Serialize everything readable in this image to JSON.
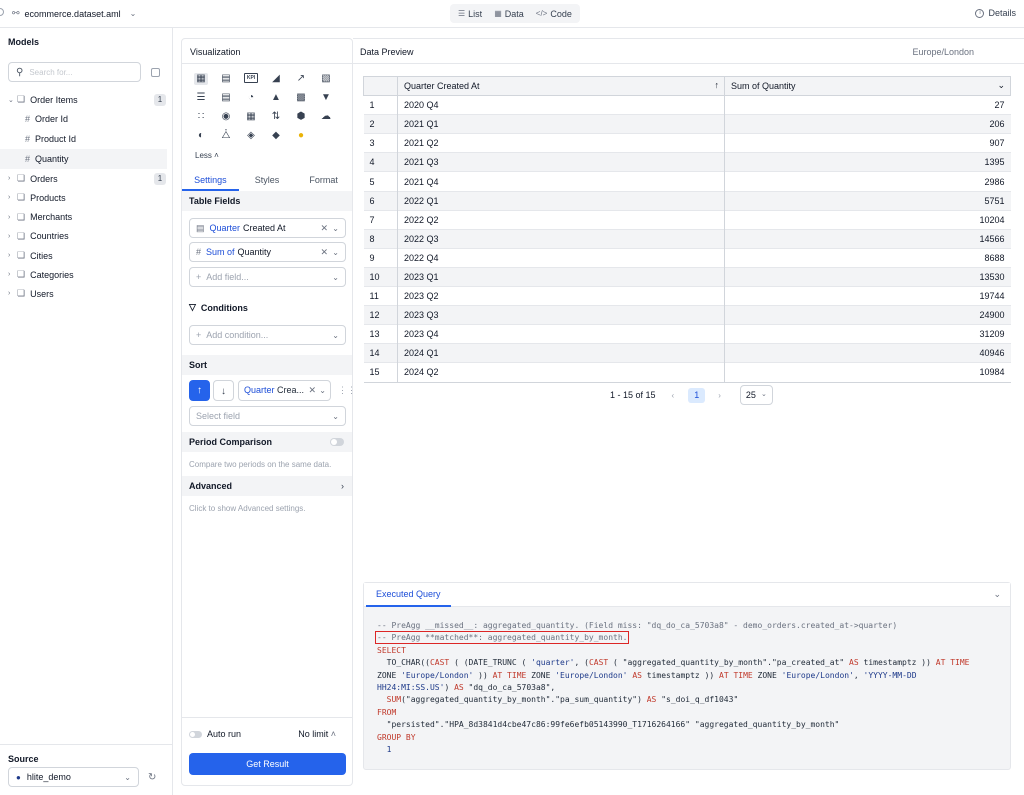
{
  "topbar": {
    "dataset": "ecommerce.dataset.aml",
    "tabs": [
      {
        "label": "List",
        "icon": "list-icon"
      },
      {
        "label": "Data",
        "icon": "table-icon"
      },
      {
        "label": "Code",
        "icon": "code-icon"
      }
    ],
    "details": "Details"
  },
  "sidebar": {
    "title": "Models",
    "search_placeholder": "Search for...",
    "models": [
      {
        "name": "Order Items",
        "count": "1",
        "expanded": true,
        "fields": [
          "Order Id",
          "Product Id",
          "Quantity"
        ]
      },
      {
        "name": "Orders",
        "count": "1"
      },
      {
        "name": "Products"
      },
      {
        "name": "Merchants"
      },
      {
        "name": "Countries"
      },
      {
        "name": "Cities"
      },
      {
        "name": "Categories"
      },
      {
        "name": "Users"
      }
    ],
    "source_title": "Source",
    "source_value": "hlite_demo"
  },
  "viz": {
    "title": "Visualization",
    "less": "Less",
    "kpi": "KPI",
    "tabs": [
      "Settings",
      "Styles",
      "Format"
    ],
    "table_fields_title": "Table Fields",
    "field1": {
      "prefix": "Quarter",
      "name": "Created At"
    },
    "field2": {
      "prefix": "Sum of",
      "name": "Quantity"
    },
    "add_field": "Add field...",
    "conditions_title": "Conditions",
    "add_condition": "Add condition...",
    "sort_title": "Sort",
    "sort_field": {
      "prefix": "Quarter",
      "name": "Crea..."
    },
    "select_field": "Select field",
    "period_title": "Period Comparison",
    "period_hint": "Compare two periods on the same data.",
    "advanced_title": "Advanced",
    "advanced_hint": "Click to show Advanced settings.",
    "auto_run": "Auto run",
    "no_limit": "No limit",
    "get_result": "Get Result"
  },
  "preview": {
    "title": "Data Preview",
    "timezone": "Europe/London",
    "columns": [
      "Quarter Created At",
      "Sum of Quantity"
    ],
    "rows": [
      [
        "1",
        "2020 Q4",
        "27"
      ],
      [
        "2",
        "2021 Q1",
        "206"
      ],
      [
        "3",
        "2021 Q2",
        "907"
      ],
      [
        "4",
        "2021 Q3",
        "1395"
      ],
      [
        "5",
        "2021 Q4",
        "2986"
      ],
      [
        "6",
        "2022 Q1",
        "5751"
      ],
      [
        "7",
        "2022 Q2",
        "10204"
      ],
      [
        "8",
        "2022 Q3",
        "14566"
      ],
      [
        "9",
        "2022 Q4",
        "8688"
      ],
      [
        "10",
        "2023 Q1",
        "13530"
      ],
      [
        "11",
        "2023 Q2",
        "19744"
      ],
      [
        "12",
        "2023 Q3",
        "24900"
      ],
      [
        "13",
        "2023 Q4",
        "31209"
      ],
      [
        "14",
        "2024 Q1",
        "40946"
      ],
      [
        "15",
        "2024 Q2",
        "10984"
      ]
    ],
    "pager": {
      "range": "1 - 15 of 15",
      "page": "1",
      "page_size": "25"
    }
  },
  "query": {
    "tab": "Executed Query",
    "lines": {
      "l1": "-- PreAgg __missed__: aggregated_quantity. (Field miss: \"dq_do_ca_5703a8\" - demo_orders.created_at->quarter)",
      "l2": "-- PreAgg **matched**: aggregated_quantity_by_month.",
      "l3": "SELECT",
      "l8": "FROM",
      "l9": "  \"persisted\".\"HPA_8d3841d4cbe47c86:99fe6efb05143990_T1716264166\" \"aggregated_quantity_by_month\"",
      "l10": "GROUP BY",
      "l11": "  1"
    },
    "select_body": {
      "a1": "  TO_CHAR((",
      "a2": "CAST",
      "a3": " ( (DATE_TRUNC ( ",
      "a4": "'quarter'",
      "a5": ", (",
      "a6": "CAST",
      "a7": " ( \"aggregated_quantity_by_month\".\"pa_created_at\" ",
      "a8": "AS",
      "a9": " timestamptz )) ",
      "a10": "AT TIME",
      "b1": "ZONE ",
      "b2": "'Europe/London'",
      "b3": " )) ",
      "b4": "AT TIME",
      "b5": " ZONE ",
      "b6": "'Europe/London'",
      "b7": " ",
      "b8": "AS",
      "b9": " timestamptz )) ",
      "b10": "AT TIME",
      "b11": " ZONE ",
      "b12": "'Europe/London'",
      "b13": ", ",
      "b14": "'YYYY-MM-DD",
      "c1": "HH24:MI:SS.US'",
      "c2": ") ",
      "c3": "AS",
      "c4": " \"dq_do_ca_5703a8\",",
      "d1": "  ",
      "d2": "SUM",
      "d3": "(\"aggregated_quantity_by_month\".\"pa_sum_quantity\") ",
      "d4": "AS",
      "d5": " \"s_doi_q_df1043\""
    }
  }
}
